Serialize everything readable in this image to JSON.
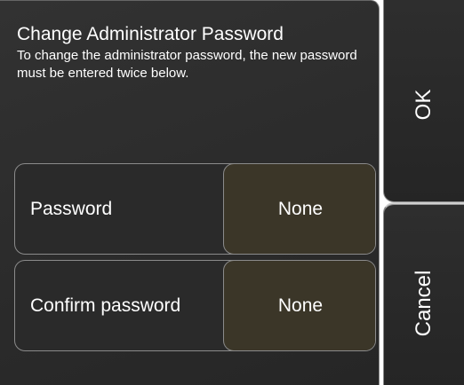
{
  "dialog": {
    "title": "Change Administrator Password",
    "description": "To change the administrator password, the new password must be entered twice below."
  },
  "fields": [
    {
      "label": "Password",
      "value": "None"
    },
    {
      "label": "Confirm password",
      "value": "None"
    }
  ],
  "buttons": {
    "ok_label": "OK",
    "cancel_label": "Cancel"
  },
  "colors": {
    "panel_background": "#2b2b2b",
    "value_background": "#3b3628",
    "border": "#8b8b8b",
    "text": "#ffffff"
  }
}
